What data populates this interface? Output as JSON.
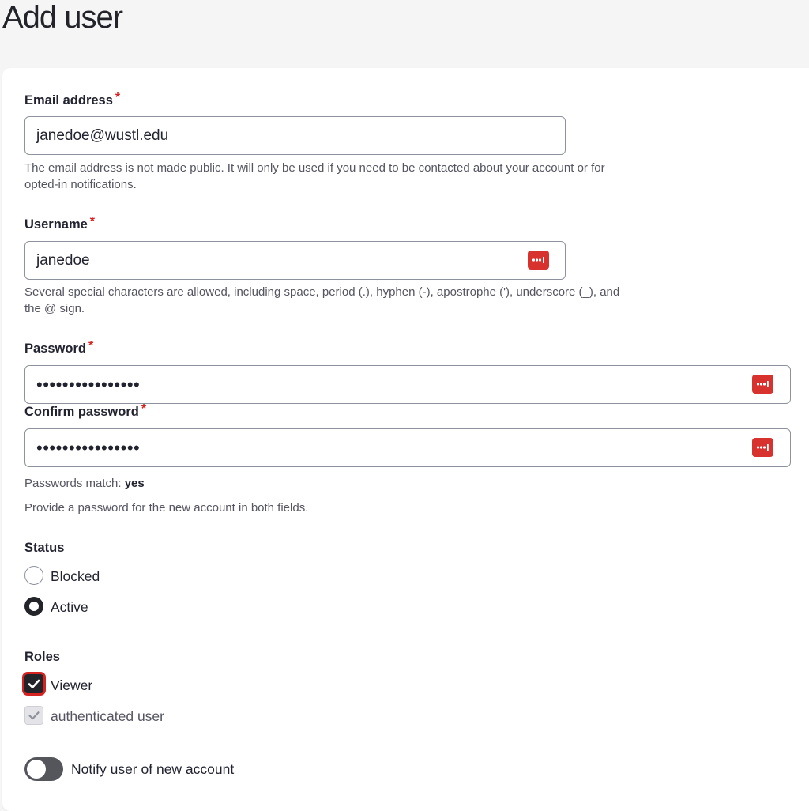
{
  "page": {
    "title": "Add user"
  },
  "form": {
    "email": {
      "label": "Email address",
      "required_mark": "*",
      "value": "janedoe@wustl.edu",
      "description": "The email address is not made public. It will only be used if you need to be contacted about your account or for opted-in notifications."
    },
    "username": {
      "label": "Username",
      "required_mark": "*",
      "value": "janedoe",
      "description": "Several special characters are allowed, including space, period (.), hyphen (-), apostrophe ('), underscore (_), and the @ sign.",
      "icon": "password-manager-icon"
    },
    "password": {
      "label": "Password",
      "required_mark": "*",
      "masked_value": "••••••••••••••••",
      "icon": "password-manager-icon"
    },
    "confirm_password": {
      "label": "Confirm password",
      "required_mark": "*",
      "masked_value": "••••••••••••••••",
      "icon": "password-manager-icon"
    },
    "password_match": {
      "prefix": "Passwords match: ",
      "value": "yes"
    },
    "password_hint": "Provide a password for the new account in both fields.",
    "status": {
      "label": "Status",
      "options": [
        {
          "label": "Blocked",
          "selected": false
        },
        {
          "label": "Active",
          "selected": true
        }
      ]
    },
    "roles": {
      "label": "Roles",
      "options": [
        {
          "label": "Viewer",
          "checked": true,
          "disabled": false
        },
        {
          "label": "authenticated user",
          "checked": true,
          "disabled": true
        }
      ]
    },
    "notify": {
      "label": "Notify user of new account",
      "on": false
    }
  },
  "colors": {
    "required_asterisk": "#d72222",
    "password_manager_icon": "#d8322f",
    "focus_outline": "#d72222",
    "control_dark": "#232429"
  }
}
